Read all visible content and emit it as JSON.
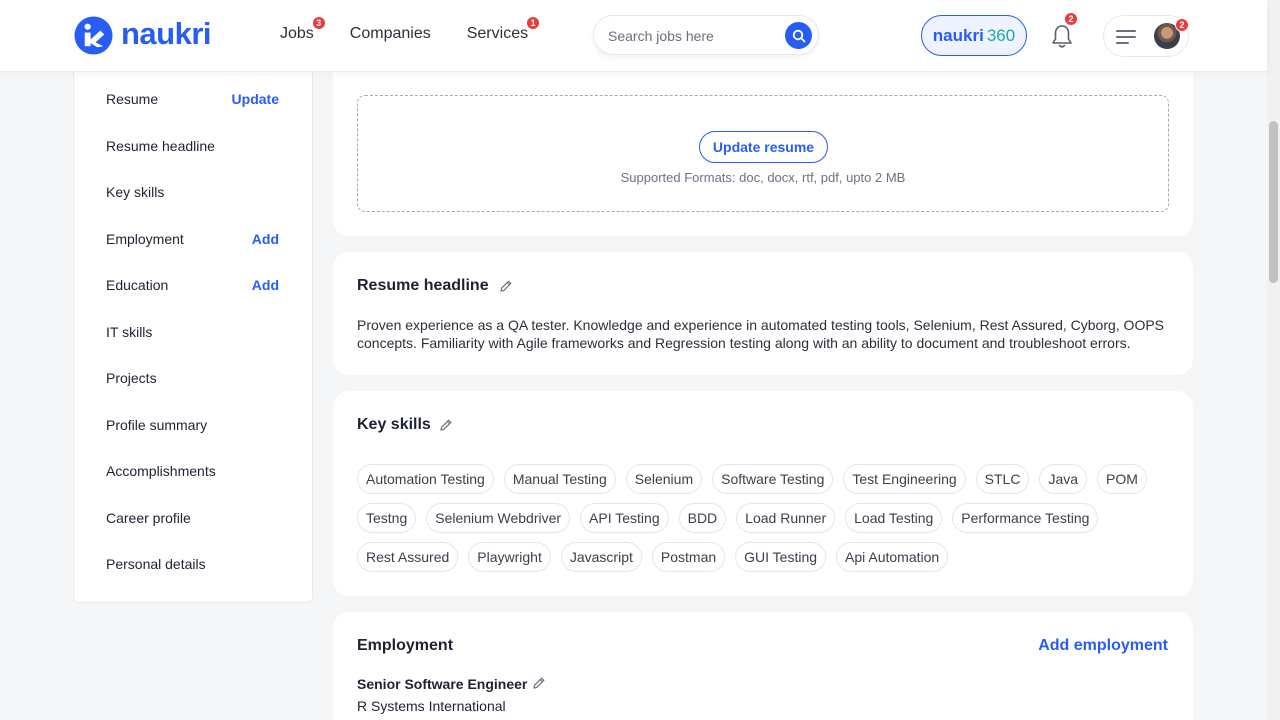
{
  "header": {
    "logo_text": "naukri",
    "nav": [
      {
        "label": "Jobs",
        "badge": "3"
      },
      {
        "label": "Companies",
        "badge": ""
      },
      {
        "label": "Services",
        "badge": "1"
      }
    ],
    "search_placeholder": "Search jobs here",
    "naukri360": {
      "brand": "naukri",
      "num": "360"
    },
    "notifications_badge": "2",
    "menu_badge": "2",
    "accent_color": "#275df5",
    "badge_color": "#ec3b3b"
  },
  "sidebar": {
    "items": [
      {
        "label": "Resume",
        "action": "Update"
      },
      {
        "label": "Resume headline",
        "action": ""
      },
      {
        "label": "Key skills",
        "action": ""
      },
      {
        "label": "Employment",
        "action": "Add"
      },
      {
        "label": "Education",
        "action": "Add"
      },
      {
        "label": "IT skills",
        "action": ""
      },
      {
        "label": "Projects",
        "action": ""
      },
      {
        "label": "Profile summary",
        "action": ""
      },
      {
        "label": "Accomplishments",
        "action": ""
      },
      {
        "label": "Career profile",
        "action": ""
      },
      {
        "label": "Personal details",
        "action": ""
      }
    ]
  },
  "resume": {
    "button": "Update resume",
    "formats": "Supported Formats: doc, docx, rtf, pdf, upto 2 MB"
  },
  "headline": {
    "title": "Resume headline",
    "text": "Proven experience as a QA tester. Knowledge and experience in automated testing tools, Selenium, Rest Assured, Cyborg, OOPS concepts. Familiarity with Agile frameworks and Regression testing along with an ability to document and troubleshoot errors."
  },
  "skills": {
    "title": "Key skills",
    "items": [
      "Automation Testing",
      "Manual Testing",
      "Selenium",
      "Software Testing",
      "Test Engineering",
      "STLC",
      "Java",
      "POM",
      "Testng",
      "Selenium Webdriver",
      "API Testing",
      "BDD",
      "Load Runner",
      "Load Testing",
      "Performance Testing",
      "Rest Assured",
      "Playwright",
      "Javascript",
      "Postman",
      "GUI Testing",
      "Api Automation"
    ]
  },
  "employment": {
    "title": "Employment",
    "add_label": "Add employment",
    "job_title": "Senior Software Engineer",
    "company": "R Systems International"
  }
}
